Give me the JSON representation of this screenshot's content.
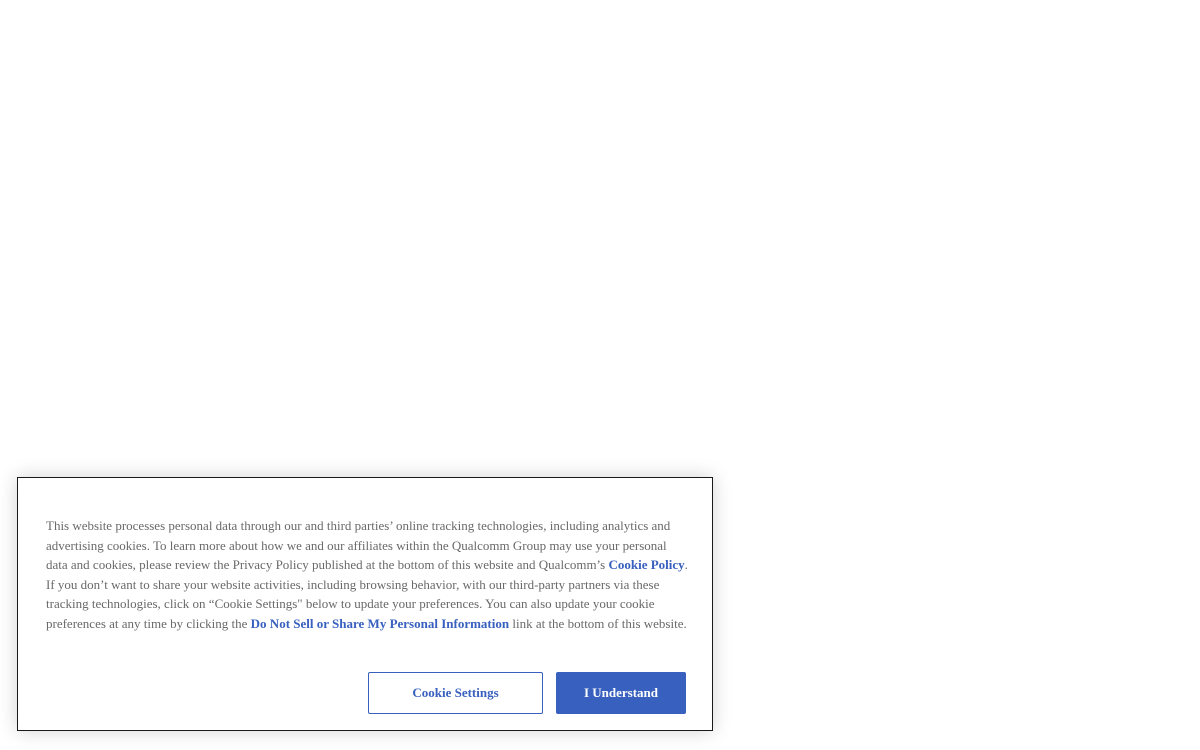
{
  "cookie_banner": {
    "text_1": "This website processes personal data through our and third parties’ online tracking technologies, including analytics and advertising cookies. To learn more about how we and our affiliates within the Qualcomm Group may use your personal data and cookies, please review the Privacy Policy published at the bottom of this website and Qualcomm’s ",
    "cookie_policy_link": "Cookie Policy",
    "text_2": ". If you don’t want to share your website activities, including browsing behavior, with our third-party partners via these tracking technologies, click on “Cookie Settings\" below to update your preferences. You can also update your cookie preferences at any time by clicking the ",
    "do_not_sell_link": "Do Not Sell or Share My Personal Information",
    "text_3": " link at the bottom of this website.",
    "settings_button_label": "Cookie Settings",
    "accept_button_label": "I Understand"
  },
  "colors": {
    "accent": "#3860be",
    "body_text": "#696969",
    "border": "#1a1a1a"
  }
}
